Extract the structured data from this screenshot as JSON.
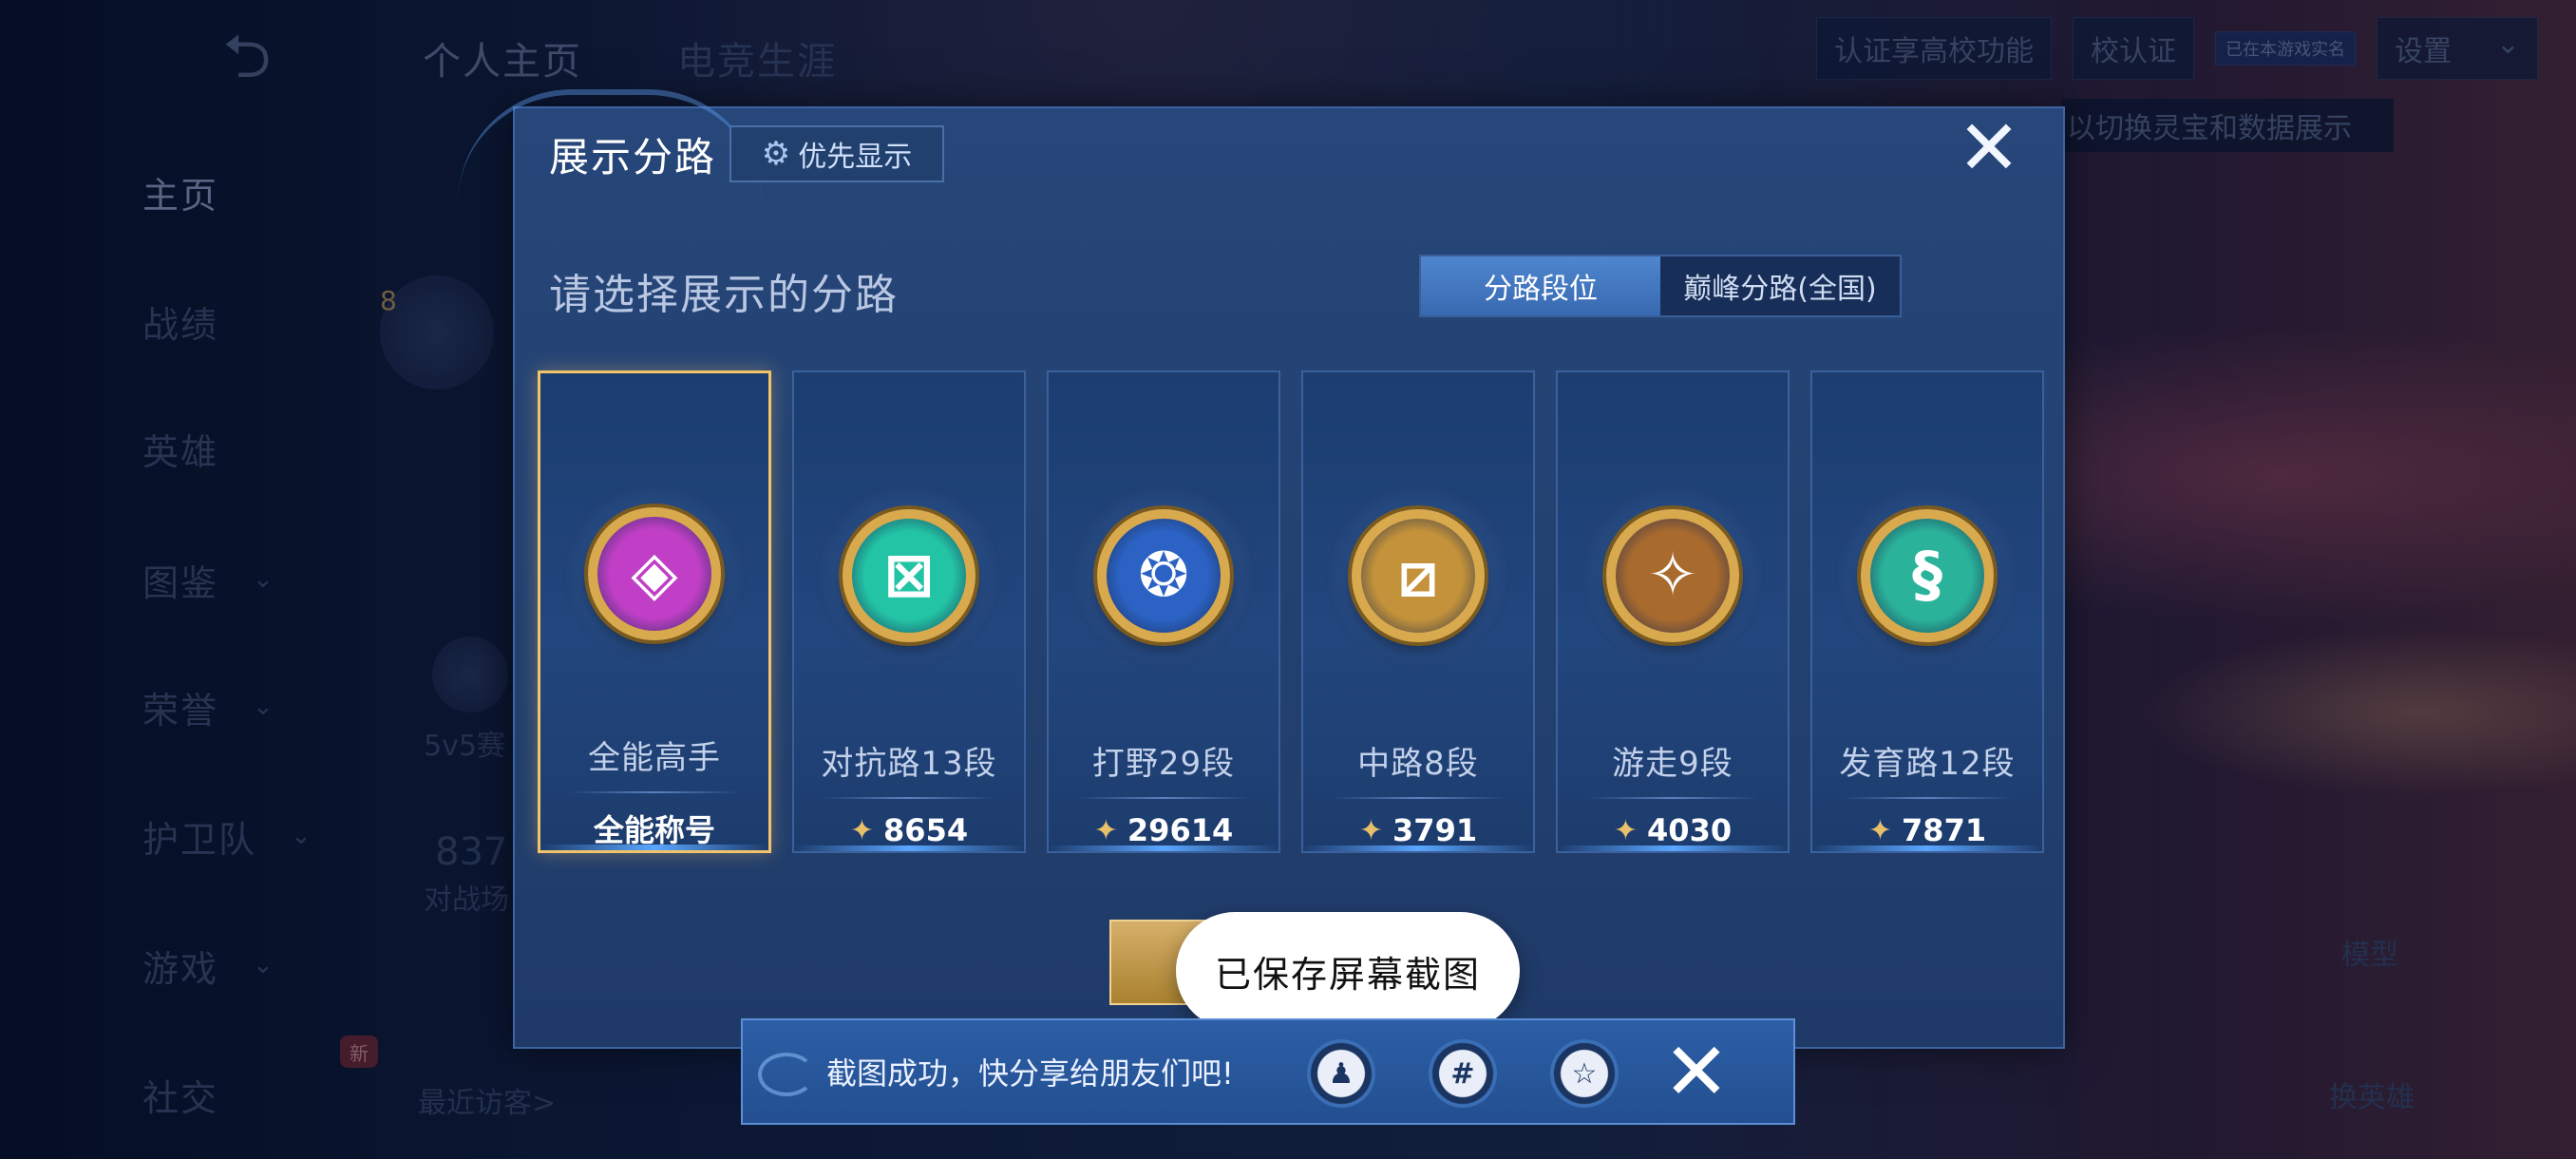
{
  "sidebar": {
    "items": [
      {
        "label": "主页",
        "active": true
      },
      {
        "label": "战绩"
      },
      {
        "label": "英雄"
      },
      {
        "label": "图鉴",
        "chevron": true
      },
      {
        "label": "荣誉",
        "chevron": true
      },
      {
        "label": "护卫队",
        "chevron": true
      },
      {
        "label": "游戏",
        "chevron": true
      },
      {
        "label": "社交",
        "badge": "新"
      }
    ]
  },
  "top_tabs": [
    "个人主页",
    "电竞生涯"
  ],
  "top_right": {
    "cert_label": "认证享高校功能",
    "school_label": "校认证",
    "small_badge": "已在本游戏实名",
    "settings_label": "设置",
    "hint": "以切换灵宝和数据展示"
  },
  "background": {
    "level": "8",
    "mode": "5v5赛",
    "count": "837",
    "battle": "对战场",
    "recent": "最近访客>",
    "right_labels": [
      "模型",
      "换英雄"
    ],
    "right_new": "新"
  },
  "modal": {
    "title": "展示分路",
    "priority_label": "优先显示",
    "close_icon": "close-icon",
    "subtitle": "请选择展示的分路",
    "segments": [
      {
        "label": "分路段位",
        "active": true
      },
      {
        "label": "巅峰分路(全国)",
        "active": false
      }
    ],
    "cards": [
      {
        "label": "全能高手",
        "value": "全能称号",
        "selected": true,
        "emblem_color": "#c13fc7",
        "glyph": "◈",
        "value_icon": false
      },
      {
        "label": "对抗路13段",
        "value": "8654",
        "selected": false,
        "emblem_color": "#23c4a6",
        "glyph": "⊠",
        "value_icon": true
      },
      {
        "label": "打野29段",
        "value": "29614",
        "selected": false,
        "emblem_color": "#2b62c4",
        "glyph": "❂",
        "value_icon": true
      },
      {
        "label": "中路8段",
        "value": "3791",
        "selected": false,
        "emblem_color": "#c4923a",
        "glyph": "⧄",
        "value_icon": true
      },
      {
        "label": "游走9段",
        "value": "4030",
        "selected": false,
        "emblem_color": "#a96a2e",
        "glyph": "✧",
        "value_icon": true
      },
      {
        "label": "发育路12段",
        "value": "7871",
        "selected": false,
        "emblem_color": "#2ab39a",
        "glyph": "§",
        "value_icon": true
      }
    ]
  },
  "toast": {
    "text": "已保存屏幕截图"
  },
  "share": {
    "text": "截图成功，快分享给朋友们吧!",
    "icons": [
      {
        "name": "qq-icon",
        "glyph": "♟"
      },
      {
        "name": "wechat-moments-icon",
        "glyph": "#"
      },
      {
        "name": "qzone-icon",
        "glyph": "☆"
      }
    ]
  },
  "colors": {
    "accent": "#f2c36a",
    "panel": "#22406f",
    "share_bar": "#2c5ea6"
  }
}
